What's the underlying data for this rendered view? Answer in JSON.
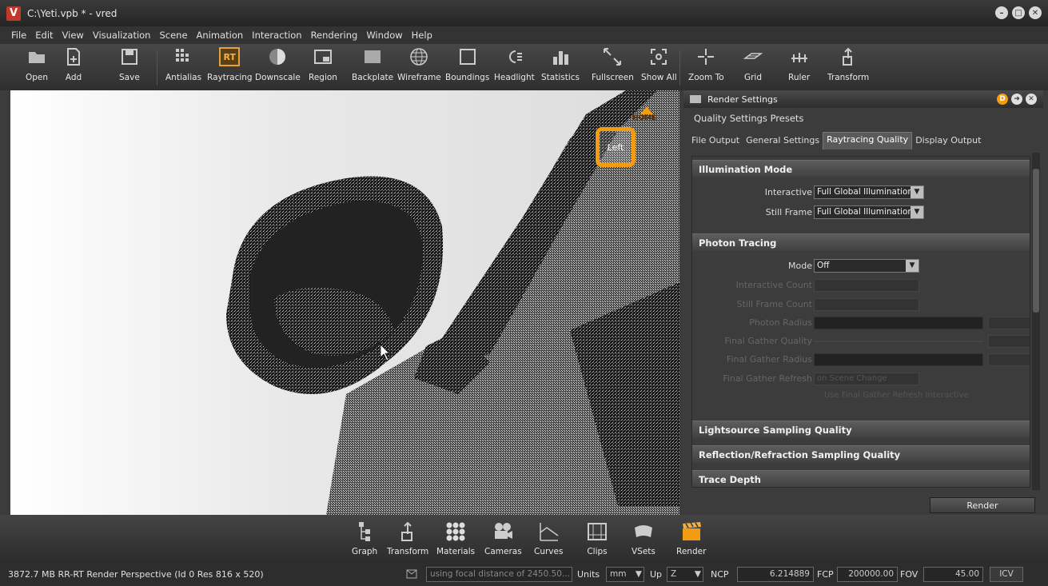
{
  "window": {
    "title": "C:\\Yeti.vpb * - vred",
    "logo": "V"
  },
  "menu": [
    "File",
    "Edit",
    "View",
    "Visualization",
    "Scene",
    "Animation",
    "Interaction",
    "Rendering",
    "Window",
    "Help"
  ],
  "toolbar": {
    "open": "Open",
    "add": "Add",
    "save": "Save",
    "antialias": "Antialias",
    "raytracing": "Raytracing",
    "raytracing_icon": "RT",
    "downscale": "Downscale",
    "region": "Region",
    "backplate": "Backplate",
    "wireframe": "Wireframe",
    "boundings": "Boundings",
    "headlight": "Headlight",
    "statistics": "Statistics",
    "fullscreen": "Fullscreen",
    "showall": "Show All",
    "zoomto": "Zoom To",
    "grid": "Grid",
    "ruler": "Ruler",
    "transform": "Transform"
  },
  "viewport": {
    "navcube_label": "Left",
    "home_label": "HOME"
  },
  "panel": {
    "title": "Render Settings",
    "presets": "Quality Settings Presets",
    "tabs": [
      "File Output",
      "General Settings",
      "Raytracing Quality",
      "Display Output"
    ],
    "active_tab": "Raytracing Quality",
    "illumination": {
      "header": "Illumination Mode",
      "interactive_label": "Interactive",
      "interactive_value": "Full Global Illumination",
      "still_label": "Still Frame",
      "still_value": "Full Global Illumination"
    },
    "photon": {
      "header": "Photon Tracing",
      "mode_label": "Mode",
      "mode_value": "Off",
      "interactive_count": "Interactive Count",
      "still_count": "Still Frame Count",
      "photon_radius": "Photon Radius",
      "final_gather_quality": "Final Gather Quality",
      "final_gather_radius": "Final Gather Radius",
      "final_gather_refresh": "Final Gather Refresh",
      "refresh_value": "on Scene Change",
      "refresh_options": "Use Final Gather  Refresh Interactive"
    },
    "sections": [
      "Lightsource Sampling Quality",
      "Reflection/Refraction Sampling Quality",
      "Trace Depth"
    ],
    "render_button": "Render"
  },
  "modules": [
    "Graph",
    "Transform",
    "Materials",
    "Cameras",
    "Curves",
    "Clips",
    "VSets",
    "Render"
  ],
  "status": {
    "left": "3872.7 MB  RR-RT  Render Perspective (Id 0 Res 816 x 520)",
    "focal": "using focal distance of 2450.50...",
    "units_label": "Units",
    "units_value": "mm",
    "up_label": "Up",
    "up_value": "Z",
    "ncp_label": "NCP",
    "ncp_value": "6.214889",
    "fcp_label": "FCP",
    "fcp_value": "200000.00",
    "fov_label": "FOV",
    "fov_value": "45.00",
    "icv": "ICV"
  }
}
